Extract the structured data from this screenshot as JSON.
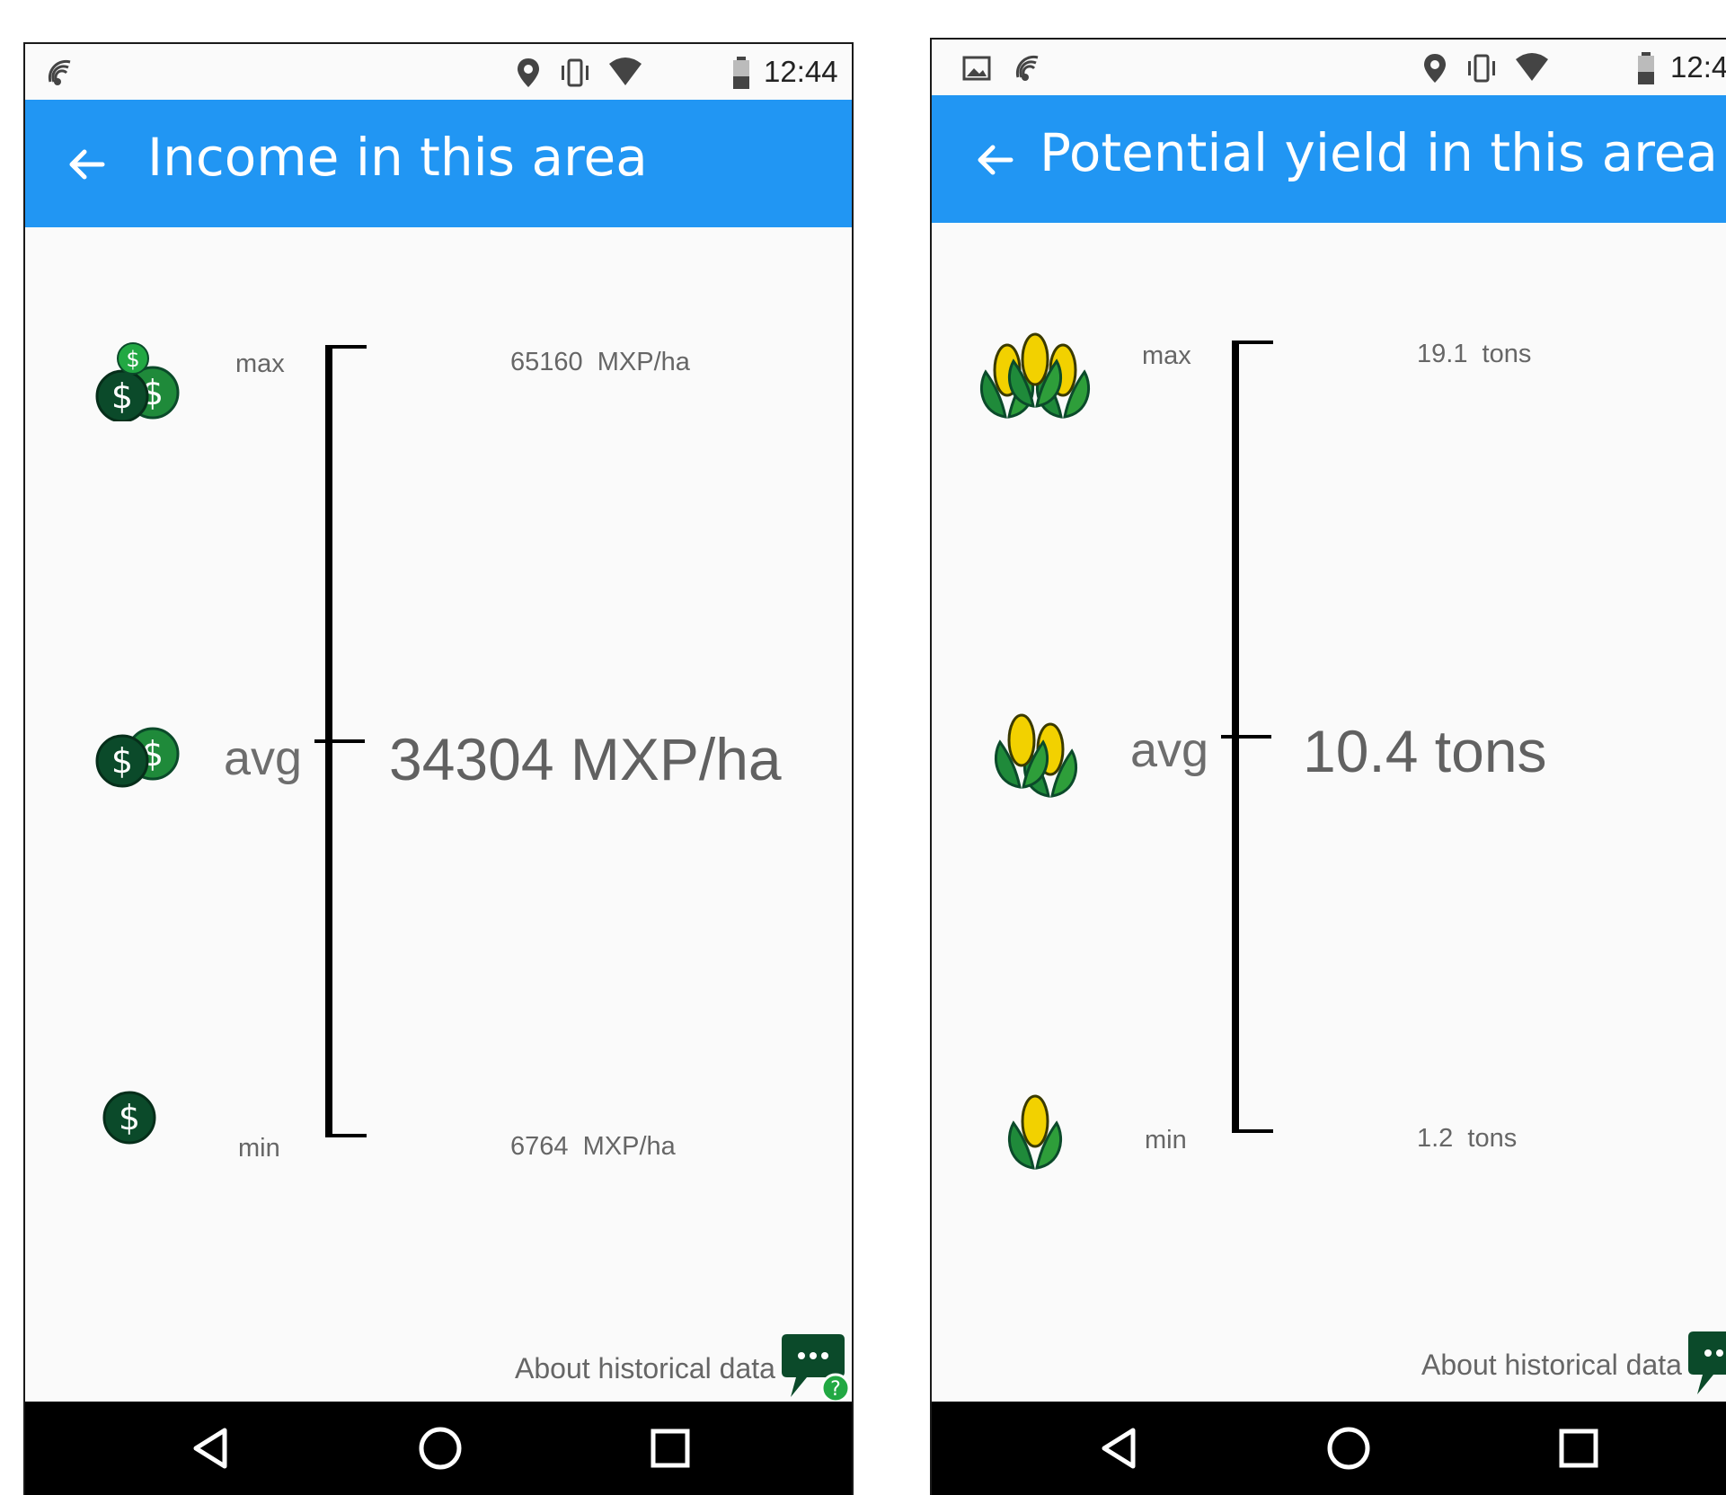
{
  "status_bar": {
    "time_left": "12:44",
    "time_right": "12:4"
  },
  "income_screen": {
    "title": "Income in this area",
    "labels": {
      "max": "max",
      "avg": "avg",
      "min": "min"
    },
    "max_value": "65160  MXP/ha",
    "avg_value": "34304 MXP/ha",
    "min_value": "6764  MXP/ha",
    "about_label": "About historical data"
  },
  "yield_screen": {
    "title": "Potential yield in this area",
    "labels": {
      "max": "max",
      "avg": "avg",
      "min": "min"
    },
    "max_value": "19.1  tons",
    "avg_value": "10.4 tons",
    "min_value": "1.2  tons",
    "about_label": "About historical data"
  },
  "colors": {
    "app_bar": "#2196f3",
    "dark_green": "#0b4a2a",
    "mid_green": "#1f8a3a",
    "leaf_green": "#2e9e3a",
    "corn_yellow": "#f2d100"
  },
  "icons": {
    "status": [
      "cast-icon",
      "location-icon",
      "vibrate-icon",
      "wifi-icon",
      "battery-icon",
      "image-icon"
    ],
    "nav": [
      "back-triangle-icon",
      "home-circle-icon",
      "recents-square-icon"
    ],
    "app": [
      "arrow-back-icon",
      "money-stack-icon",
      "corn-icon",
      "chat-help-icon"
    ]
  }
}
